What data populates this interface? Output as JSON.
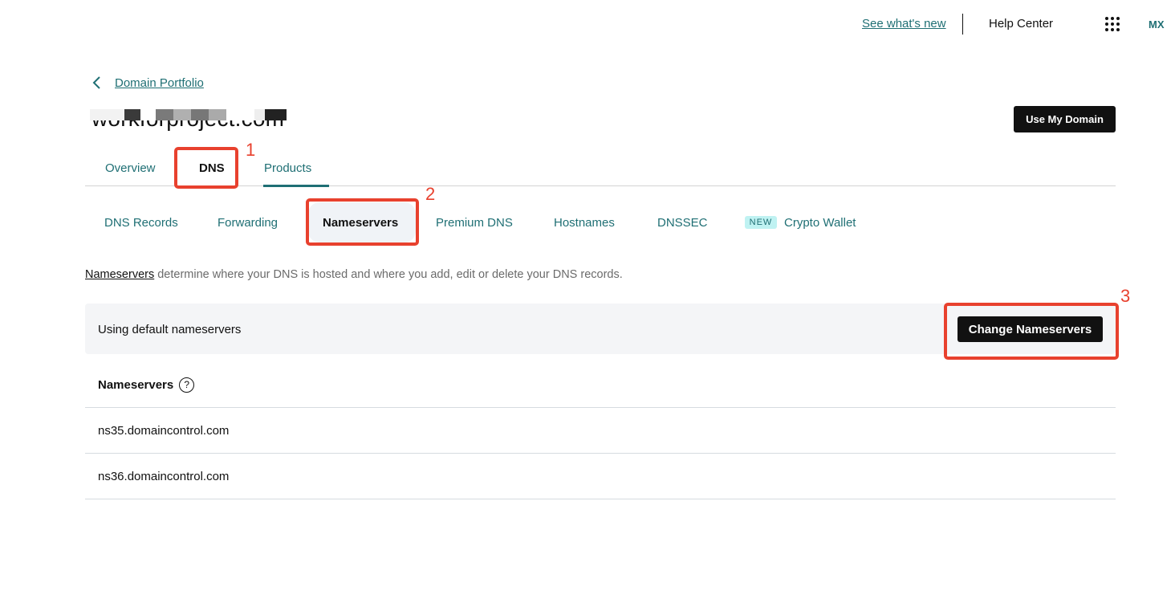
{
  "topbar": {
    "whats_new": "See what's new",
    "help_center": "Help Center",
    "apps_icon": "apps-grid-icon",
    "avatar_initials": "MX"
  },
  "breadcrumb": {
    "back_icon": "chevron-left-icon",
    "label": "Domain Portfolio"
  },
  "domain": {
    "title": "workforproject.com",
    "use_my_domain": "Use My Domain"
  },
  "main_tabs": [
    {
      "label": "Overview",
      "active": false
    },
    {
      "label": "DNS",
      "active": true
    },
    {
      "label": "Products",
      "active": false
    }
  ],
  "sub_tabs": [
    {
      "label": "DNS Records",
      "active": false
    },
    {
      "label": "Forwarding",
      "active": false
    },
    {
      "label": "Nameservers",
      "active": true
    },
    {
      "label": "Premium DNS",
      "active": false
    },
    {
      "label": "Hostnames",
      "active": false
    },
    {
      "label": "DNSSEC",
      "active": false
    },
    {
      "label": "Crypto Wallet",
      "active": false,
      "badge": "NEW"
    }
  ],
  "description": {
    "link": "Nameservers",
    "text": " determine where your DNS is hosted and where you add, edit or delete your DNS records."
  },
  "status": {
    "text": "Using default nameservers",
    "button": "Change Nameservers"
  },
  "nameservers": {
    "header": "Nameservers",
    "help_icon": "?",
    "items": [
      "ns35.domaincontrol.com",
      "ns36.domaincontrol.com"
    ]
  },
  "annotations": [
    "1",
    "2",
    "3"
  ],
  "colors": {
    "accent": "#1f6f74",
    "annotation": "#e8412e",
    "button_bg": "#111111",
    "badge_bg": "#bff2f2"
  }
}
